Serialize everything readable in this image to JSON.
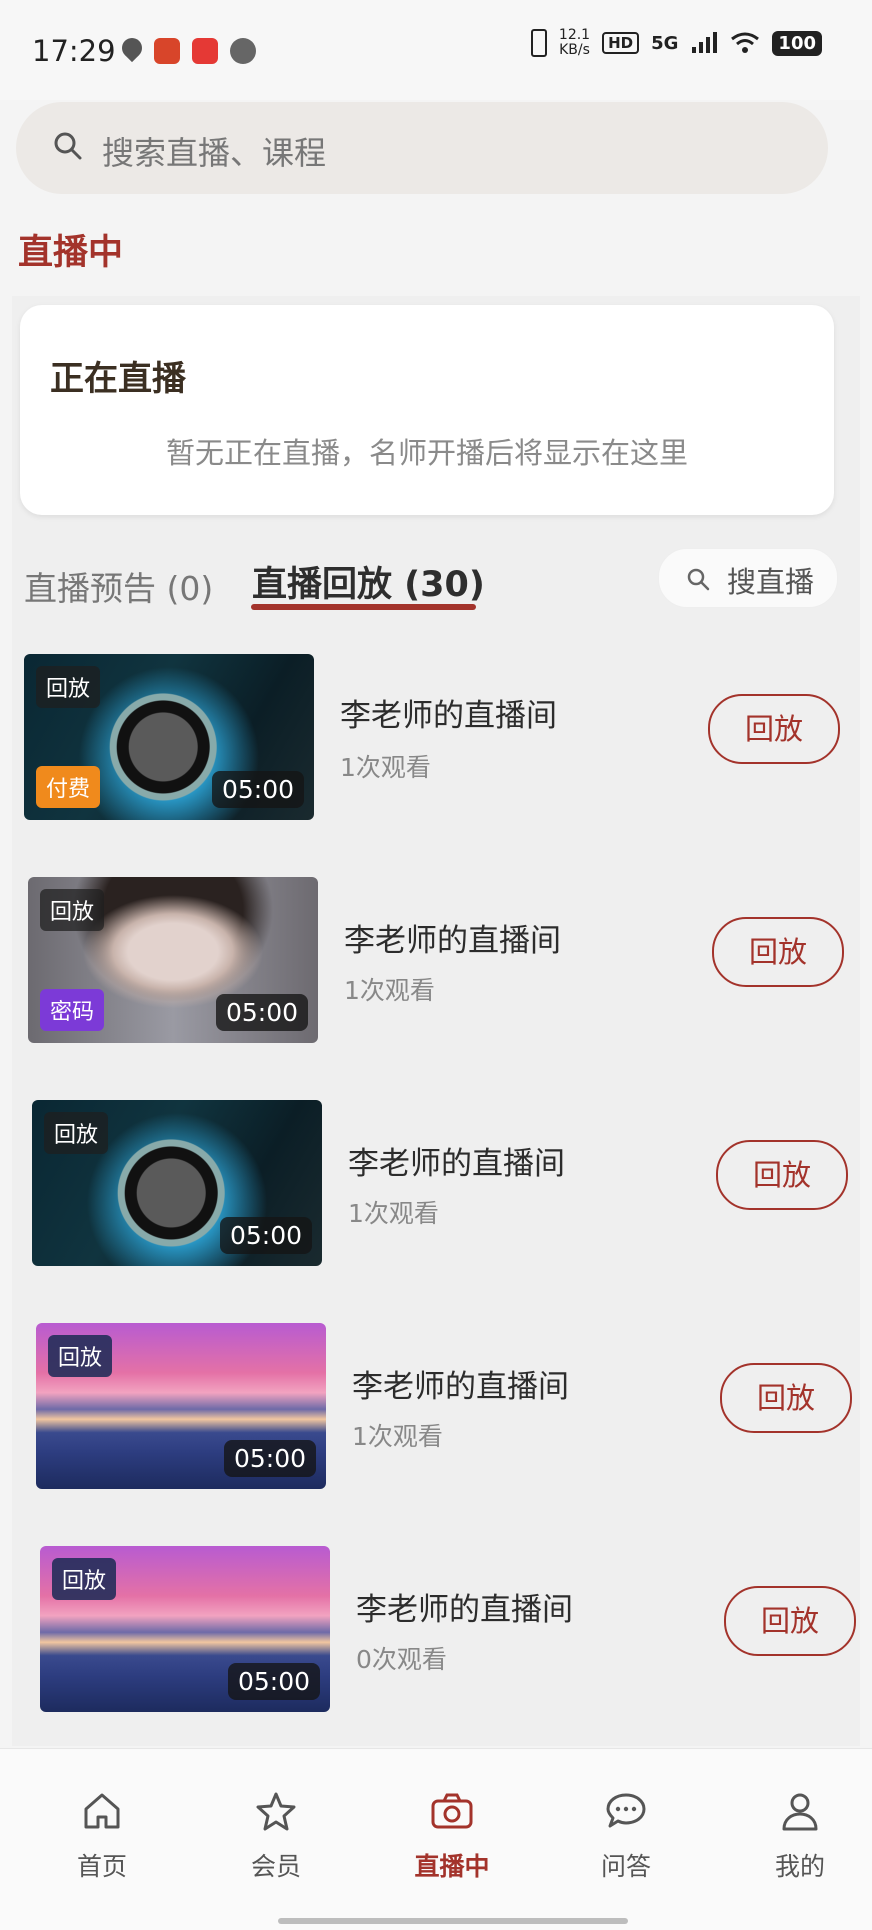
{
  "status_bar": {
    "time": "17:29",
    "net_speed": "12.1\nKB/s",
    "hd": "HD",
    "network": "5G",
    "battery": "100"
  },
  "search": {
    "placeholder": "搜索直播、课程"
  },
  "page_title": "直播中",
  "live_now": {
    "title": "正在直播",
    "empty_text": "暂无正在直播，名师开播后将显示在这里"
  },
  "tabs": {
    "preview": "直播预告 (0)",
    "replay": "直播回放 (30)",
    "search_label": "搜直播"
  },
  "replays": [
    {
      "title": "李老师的直播间",
      "views": "1次观看",
      "badge": "回放",
      "tag": "付费",
      "duration": "05:00",
      "button": "回放",
      "thumb": "ring"
    },
    {
      "title": "李老师的直播间",
      "views": "1次观看",
      "badge": "回放",
      "tag": "密码",
      "duration": "05:00",
      "button": "回放",
      "thumb": "face"
    },
    {
      "title": "李老师的直播间",
      "views": "1次观看",
      "badge": "回放",
      "tag": "",
      "duration": "05:00",
      "button": "回放",
      "thumb": "ring"
    },
    {
      "title": "李老师的直播间",
      "views": "1次观看",
      "badge": "回放",
      "tag": "",
      "duration": "05:00",
      "button": "回放",
      "thumb": "sunset"
    },
    {
      "title": "李老师的直播间",
      "views": "0次观看",
      "badge": "回放",
      "tag": "",
      "duration": "05:00",
      "button": "回放",
      "thumb": "sunset"
    }
  ],
  "nav": {
    "home": "首页",
    "member": "会员",
    "live": "直播中",
    "qa": "问答",
    "mine": "我的"
  },
  "colors": {
    "accent": "#a3332b",
    "paid_tag": "#f08a1c",
    "password_tag": "#7c3ad7"
  },
  "icons": [
    "search-icon",
    "home-icon",
    "star-icon",
    "camera-icon",
    "chat-icon",
    "user-icon"
  ]
}
